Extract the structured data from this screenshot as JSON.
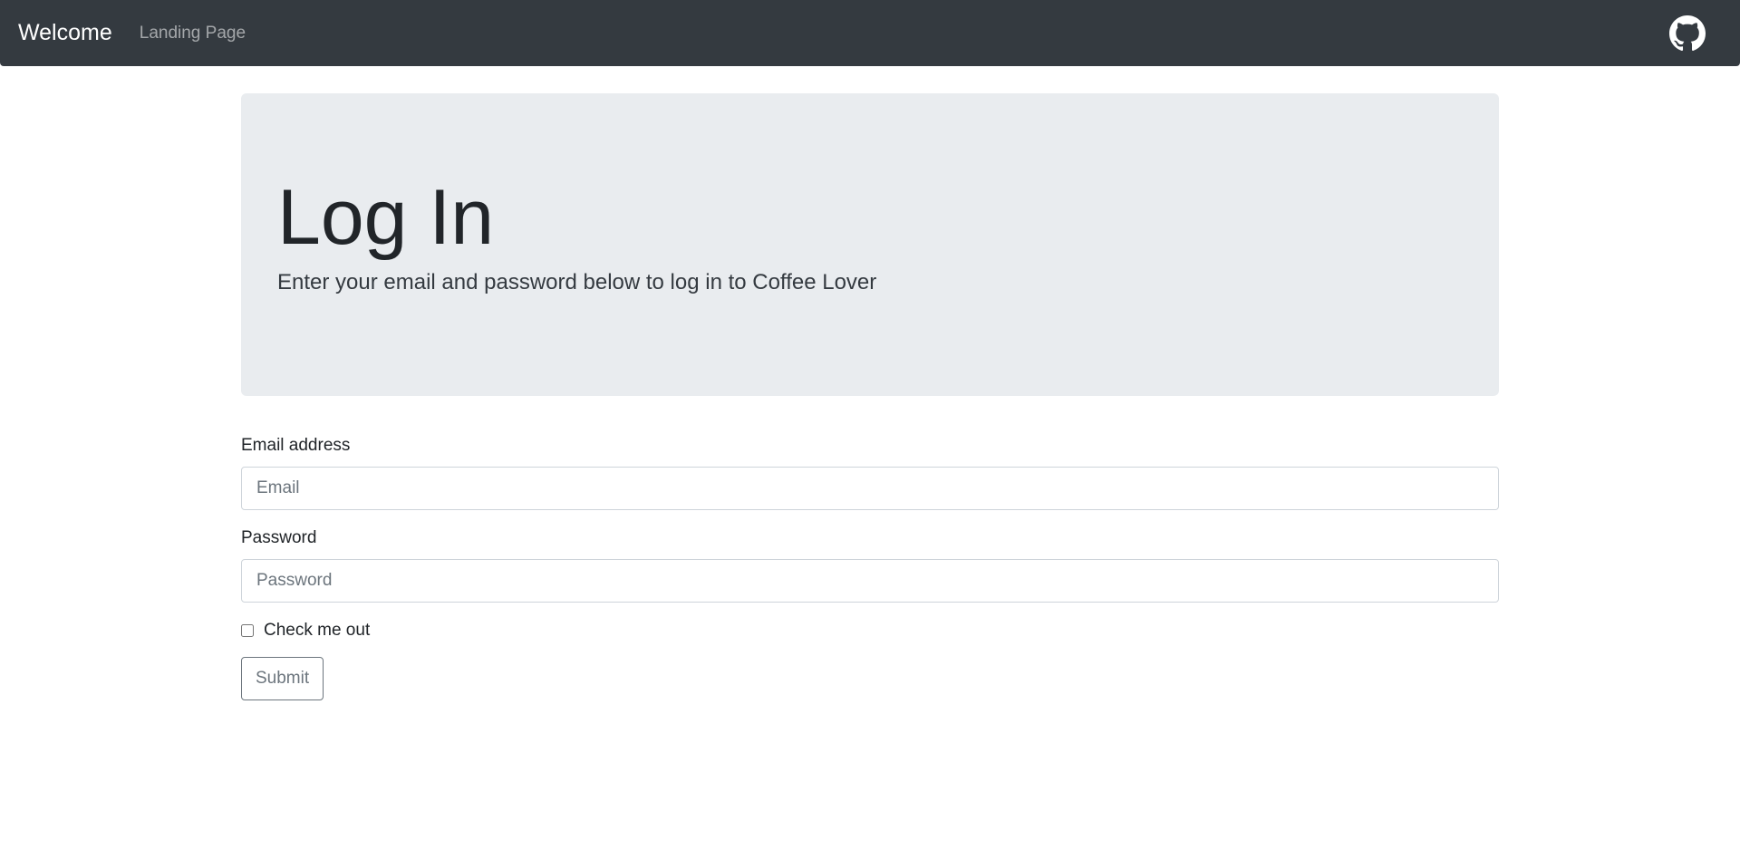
{
  "navbar": {
    "brand": "Welcome",
    "link": "Landing Page",
    "icon": "github-icon"
  },
  "jumbotron": {
    "title": "Log In",
    "lead": "Enter your email and password below to log in to Coffee Lover"
  },
  "form": {
    "email_label": "Email address",
    "email_placeholder": "Email",
    "email_value": "",
    "password_label": "Password",
    "password_placeholder": "Password",
    "password_value": "",
    "check_label": "Check me out",
    "check_checked": false,
    "submit_label": "Submit"
  },
  "colors": {
    "navbar_bg": "#343a40",
    "jumbotron_bg": "#e9ecef"
  }
}
